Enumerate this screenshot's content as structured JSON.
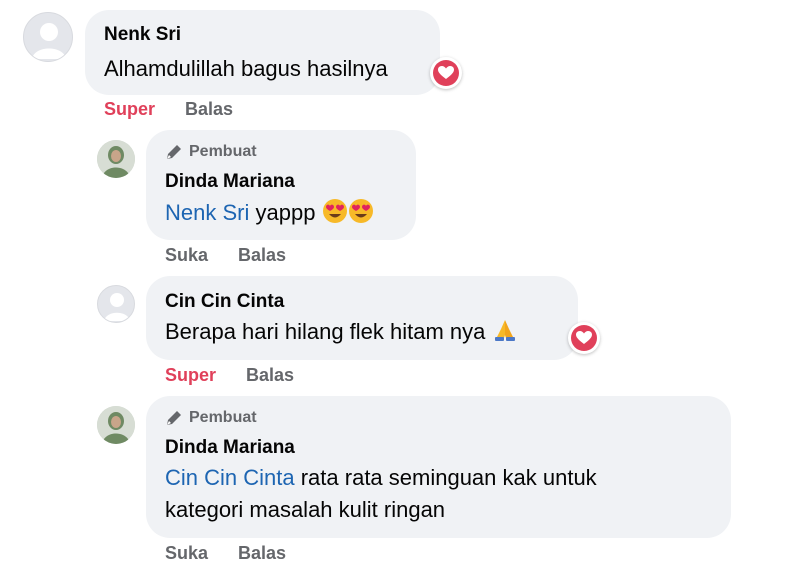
{
  "comments": [
    {
      "author": "Nenk Sri",
      "text": "Alhamdulillah bagus hasilnya",
      "actions": [
        "Super",
        "Balas"
      ]
    },
    {
      "badge": "Pembuat",
      "author": "Dinda Mariana",
      "mention": "Nenk Sri",
      "text": "yappp",
      "actions": [
        "Suka",
        "Balas"
      ]
    },
    {
      "author": "Cin Cin Cinta",
      "text": "Berapa hari hilang flek hitam nya",
      "actions": [
        "Super",
        "Balas"
      ]
    },
    {
      "badge": "Pembuat",
      "author": "Dinda Mariana",
      "mention": "Cin Cin Cinta",
      "text_line1": "rata rata seminguan kak untuk",
      "text_line2": "kategori masalah kulit ringan",
      "actions": [
        "Suka",
        "Balas"
      ]
    }
  ],
  "icons": {
    "reaction": "heart-love-reaction-icon",
    "badge": "pen-icon",
    "emoji_eyes": "heart-eyes-emoji-icon",
    "emoji_pray": "folded-hands-emoji-icon"
  },
  "colors": {
    "bubble": "#f0f2f5",
    "mention": "#1d65b2",
    "super": "#e0405a",
    "muted": "#65676b"
  }
}
